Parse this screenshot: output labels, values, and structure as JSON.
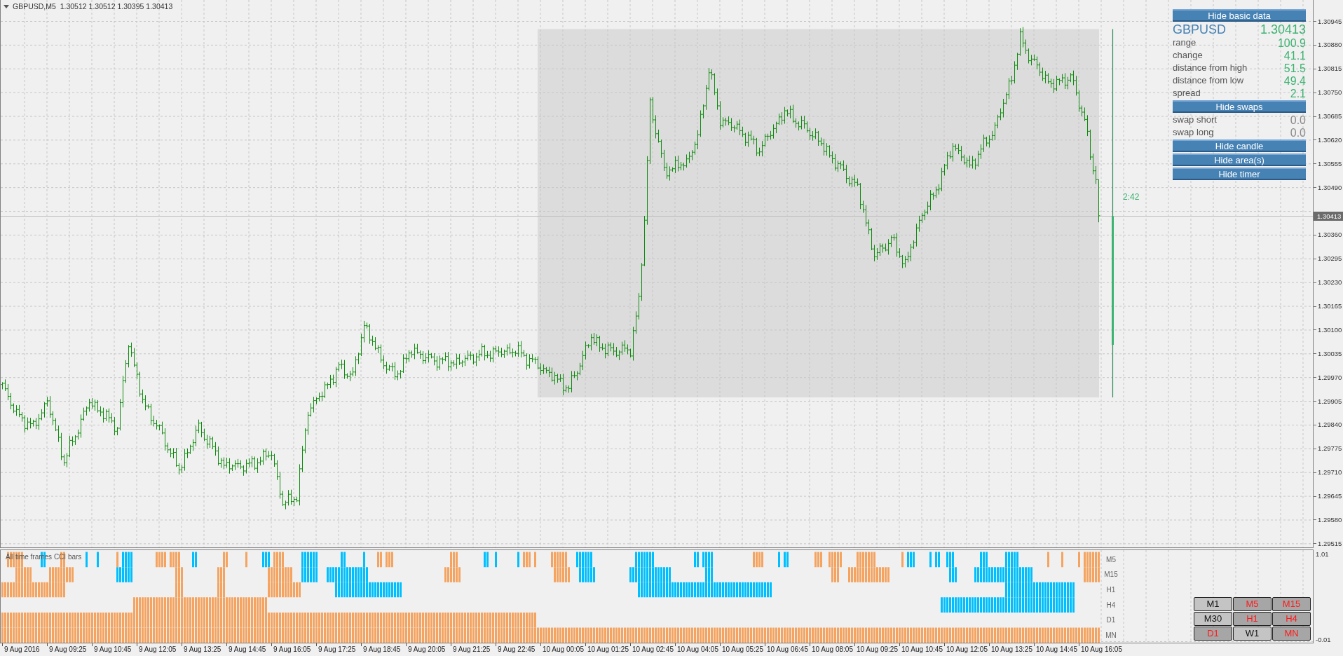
{
  "chart": {
    "title": "GBPUSD,M5  1.30512 1.30512 1.30395 1.30413",
    "timer": "2:42"
  },
  "info_panel": [
    {
      "kind": "button",
      "label": "Hide basic data"
    },
    {
      "kind": "symbol",
      "label": "GBPUSD",
      "value": "1.30413"
    },
    {
      "kind": "stat",
      "label": "range",
      "value": "100.9"
    },
    {
      "kind": "stat",
      "label": "change",
      "value": "41.1"
    },
    {
      "kind": "stat",
      "label": "distance from high",
      "value": "51.5"
    },
    {
      "kind": "stat",
      "label": "distance from low",
      "value": "49.4"
    },
    {
      "kind": "stat",
      "label": "spread",
      "value": "2.1"
    },
    {
      "kind": "button",
      "label": "Hide swaps"
    },
    {
      "kind": "swap",
      "label": "swap short",
      "value": "0.0"
    },
    {
      "kind": "swap",
      "label": "swap long",
      "value": "0.0"
    },
    {
      "kind": "button",
      "label": "Hide candle"
    },
    {
      "kind": "button",
      "label": "Hide area(s)"
    },
    {
      "kind": "button",
      "label": "Hide timer"
    }
  ],
  "price_axis": [
    {
      "kind": "tick",
      "text": "1.30945"
    },
    {
      "kind": "tick",
      "text": "1.30880"
    },
    {
      "kind": "tick",
      "text": "1.30815"
    },
    {
      "kind": "tick",
      "text": "1.30750"
    },
    {
      "kind": "tick",
      "text": "1.30685"
    },
    {
      "kind": "tick",
      "text": "1.30620"
    },
    {
      "kind": "tick",
      "text": "1.30555"
    },
    {
      "kind": "tick",
      "text": "1.30490"
    },
    {
      "kind": "current",
      "text": "1.30413"
    },
    {
      "kind": "tick",
      "text": "1.30360"
    },
    {
      "kind": "tick",
      "text": "1.30295"
    },
    {
      "kind": "tick",
      "text": "1.30230"
    },
    {
      "kind": "tick",
      "text": "1.30165"
    },
    {
      "kind": "tick",
      "text": "1.30100"
    },
    {
      "kind": "tick",
      "text": "1.30035"
    },
    {
      "kind": "tick",
      "text": "1.29970"
    },
    {
      "kind": "tick",
      "text": "1.29905"
    },
    {
      "kind": "tick",
      "text": "1.29840"
    },
    {
      "kind": "tick",
      "text": "1.29775"
    },
    {
      "kind": "tick",
      "text": "1.29710"
    },
    {
      "kind": "tick",
      "text": "1.29645"
    },
    {
      "kind": "tick",
      "text": "1.29580"
    },
    {
      "kind": "tick",
      "text": "1.29515"
    }
  ],
  "cci": {
    "title": "All time frames CCI bars",
    "rows": [
      {
        "label": "M5"
      },
      {
        "label": "M15"
      },
      {
        "label": "H1"
      },
      {
        "label": "H4"
      },
      {
        "label": "D1"
      },
      {
        "label": "MN"
      }
    ]
  },
  "cci_scale": [
    "1.01",
    "-0.01"
  ],
  "timeframe_buttons": [
    {
      "label": "M1",
      "active": false
    },
    {
      "label": "M5",
      "active": true
    },
    {
      "label": "M15",
      "active": true
    },
    {
      "label": "M30",
      "active": false
    },
    {
      "label": "H1",
      "active": true
    },
    {
      "label": "H4",
      "active": true
    },
    {
      "label": "D1",
      "active": true
    },
    {
      "label": "W1",
      "active": false
    },
    {
      "label": "MN",
      "active": true
    }
  ],
  "time_axis": [
    "9 Aug 2016",
    "9 Aug 09:25",
    "9 Aug 10:45",
    "9 Aug 12:05",
    "9 Aug 13:25",
    "9 Aug 14:45",
    "9 Aug 16:05",
    "9 Aug 17:25",
    "9 Aug 18:45",
    "9 Aug 20:05",
    "9 Aug 21:25",
    "9 Aug 22:45",
    "10 Aug 00:05",
    "10 Aug 01:25",
    "10 Aug 02:45",
    "10 Aug 04:05",
    "10 Aug 05:25",
    "10 Aug 06:45",
    "10 Aug 08:05",
    "10 Aug 09:25",
    "10 Aug 10:45",
    "10 Aug 12:05",
    "10 Aug 13:25",
    "10 Aug 14:45",
    "10 Aug 16:05"
  ]
}
